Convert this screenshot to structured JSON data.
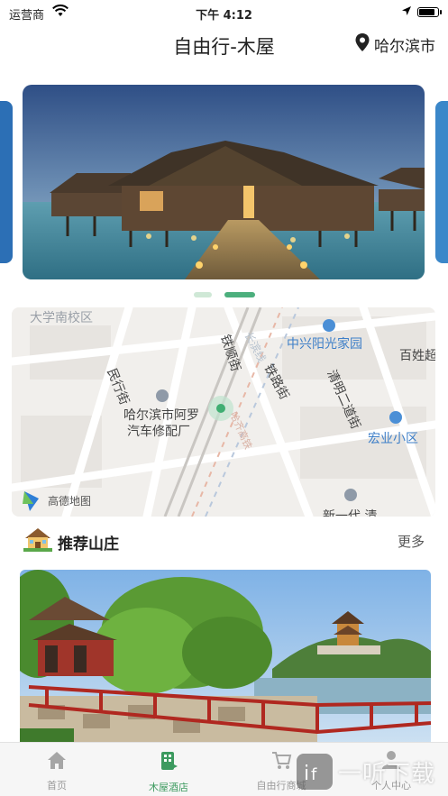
{
  "status_bar": {
    "carrier": "运营商",
    "time": "下午 4:12",
    "battery_level": 0.9
  },
  "header": {
    "title": "自由行-木屋",
    "city": "哈尔滨市",
    "location_icon": "map-pin-icon"
  },
  "banner": {
    "page_count": 2,
    "active_page": 2
  },
  "map": {
    "labels": {
      "campus": "大学南校区",
      "road_changbin": "长滨线",
      "road_tieshun": "铁顺街",
      "road_tielu": "铁路街",
      "road_minyi": "民行街",
      "road_qingming": "清明二道街",
      "poi_zhongxing": "中兴阳光家园",
      "poi_baixing": "百姓超",
      "poi_repair_1": "哈尔滨市阿罗",
      "poi_repair_2": "汽车修配厂",
      "poi_hongye": "宏业小区",
      "poi_bottom": "新一代 清",
      "faded_road": "哈齐高铁",
      "map_logo": "高德地图"
    }
  },
  "section": {
    "icon": "house-icon",
    "title": "推荐山庄",
    "more": "更多"
  },
  "tabbar": {
    "items": [
      {
        "label": "首页",
        "icon": "home-icon",
        "active": false
      },
      {
        "label": "木屋酒店",
        "icon": "hotel-icon",
        "active": true
      },
      {
        "label": "自由行商城",
        "icon": "cart-icon",
        "active": false
      },
      {
        "label": "个人中心",
        "icon": "user-icon",
        "active": false
      }
    ]
  },
  "watermark": {
    "text": "一听下载"
  },
  "colors": {
    "accent": "#3c9a5f",
    "indicator_active": "#4caf7d",
    "indicator_inactive": "#cfe8d6"
  }
}
